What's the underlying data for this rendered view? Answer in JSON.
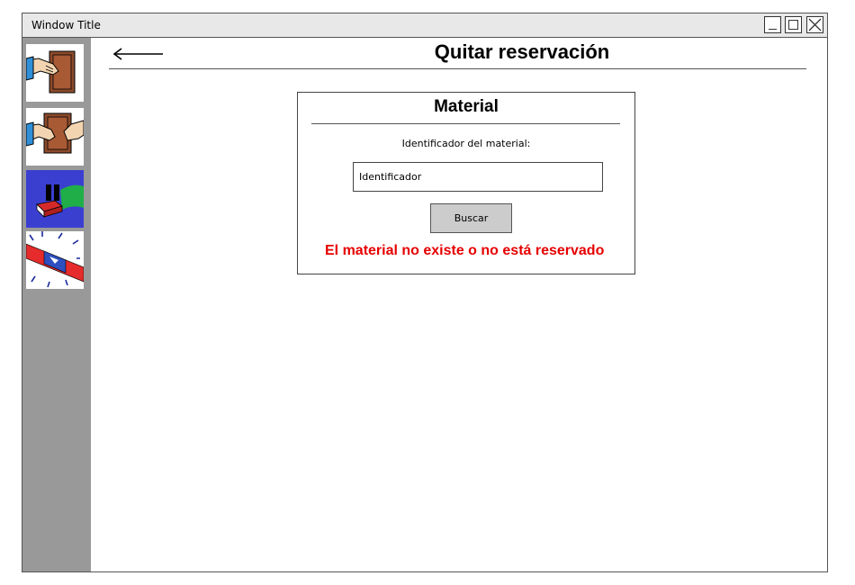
{
  "window": {
    "title": "Window Title"
  },
  "sidebar": {
    "items": [
      {
        "name": "reserve-book",
        "icon": "hand-book-icon"
      },
      {
        "name": "return-book",
        "icon": "hands-book-icon"
      },
      {
        "name": "pause-reservation",
        "icon": "pause-book-icon"
      },
      {
        "name": "alarm-siren",
        "icon": "siren-icon"
      }
    ]
  },
  "header": {
    "title": "Quitar reservación",
    "back_icon": "back-arrow-icon"
  },
  "panel": {
    "title": "Material",
    "field_label": "Identificador del material:",
    "input_placeholder": "Identificador",
    "search_label": "Buscar",
    "error_message": "El material no existe o no está reservado"
  },
  "colors": {
    "error": "#e60000",
    "sidebar": "#999999",
    "button": "#cccccc"
  }
}
